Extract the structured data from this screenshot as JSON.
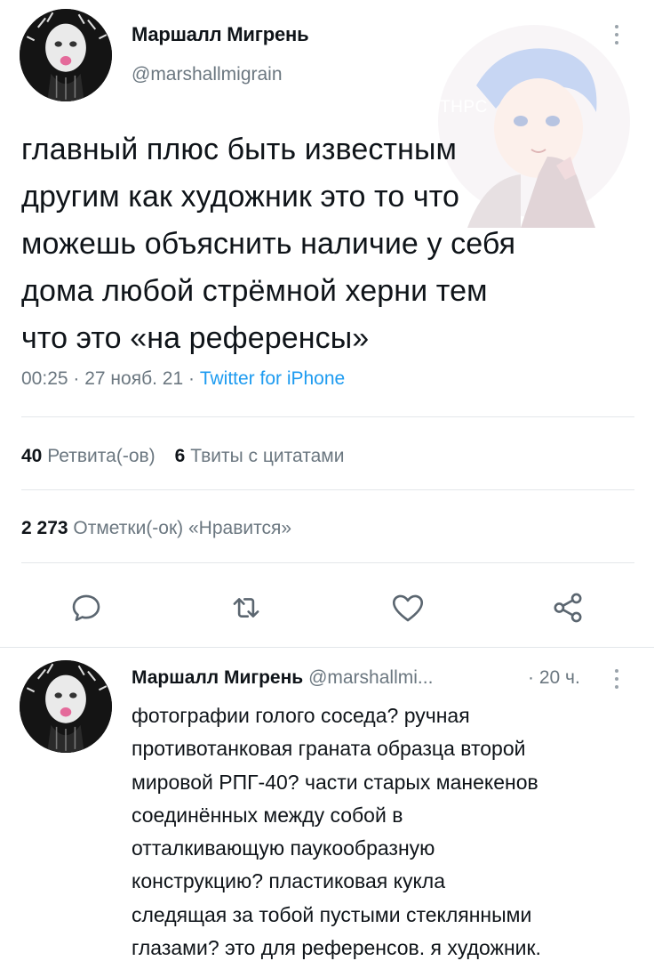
{
  "tweet": {
    "author_name": "Маршалл Мигрень",
    "author_handle": "@marshallmigrain",
    "text_lines": [
      "главный плюс быть известным",
      "другим как художник это то что",
      "можешь объяснить наличие у себя",
      "дома любой стрёмной херни тем",
      "что это «на референсы»"
    ],
    "time": "00:25",
    "date": "27 нояб. 21",
    "separator": " · ",
    "source": "Twitter for iPhone",
    "watermark": "#THPC"
  },
  "stats": {
    "retweets_count": "40",
    "retweets_label": "Ретвита(-ов)",
    "quotes_count": "6",
    "quotes_label": "Твиты с цитатами",
    "likes_count": "2 273",
    "likes_label": "Отметки(-ок) «Нравится»"
  },
  "actions": [
    {
      "name": "reply",
      "icon": "reply-icon"
    },
    {
      "name": "retweet",
      "icon": "retweet-icon"
    },
    {
      "name": "like",
      "icon": "heart-icon"
    },
    {
      "name": "share",
      "icon": "share-icon"
    }
  ],
  "reply": {
    "author_name": "Маршалл Мигрень",
    "author_handle": "@marshallmi...",
    "time": "· 20 ч.",
    "text_lines": [
      "фотографии голого соседа? ручная",
      "противотанковая граната образца второй",
      "мировой РПГ-40? части старых манекенов",
      "соединённых между собой в",
      "отталкивающую паукообразную",
      "конструкцию? пластиковая кукла",
      "следящая за тобой пустыми стеклянными",
      "глазами? это для референсов. я художник."
    ]
  },
  "colors": {
    "text": "#0f1419",
    "secondary": "#6b7780",
    "link": "#1d9bf0",
    "divider": "#e3e7ea",
    "icon": "#5b6670"
  }
}
